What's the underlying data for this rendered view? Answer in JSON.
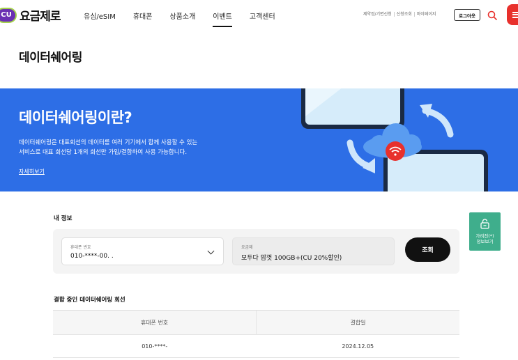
{
  "header": {
    "logo_badge": "CU",
    "logo_text": "요금제로",
    "nav": [
      "유심/eSIM",
      "휴대폰",
      "상품소개",
      "이벤트",
      "고객센터"
    ],
    "active_nav": "이벤트",
    "util_links": [
      "제약정/기변신청",
      "신청조회",
      "마이페이지"
    ],
    "logout_label": "로그아웃"
  },
  "page_title": "데이터쉐어링",
  "banner": {
    "title": "데이터쉐어링이란?",
    "desc_line1": "데이터쉐어링은 대표회선의 데이터를 여러 기기에서 함께 사용할 수 있는",
    "desc_line2": "서비스로 대표 회선당 1개의 회선만 가입/결합하여 사용 가능합니다.",
    "detail_link": "자세히보기"
  },
  "my_info": {
    "section_title": "내 정보",
    "phone_label": "휴대폰 번호",
    "phone_value": "010-****-00. .",
    "plan_label": "요금제",
    "plan_value": "모두다 맘껏 100GB+(CU 20%할인)",
    "query_label": "조회"
  },
  "mask_button": {
    "label": "가려진(*)\n정보보기"
  },
  "sharing": {
    "section_title": "결합 중인 데이터쉐어링 회선",
    "columns": [
      "휴대폰 번호",
      "결합일"
    ],
    "rows": [
      [
        "010-****-",
        "2024.12.05"
      ]
    ]
  },
  "colors": {
    "banner": "#2d6ee6",
    "brand_purple": "#6b2fb3",
    "menu_red": "#e8302c",
    "mask_green": "#3fae8c"
  }
}
